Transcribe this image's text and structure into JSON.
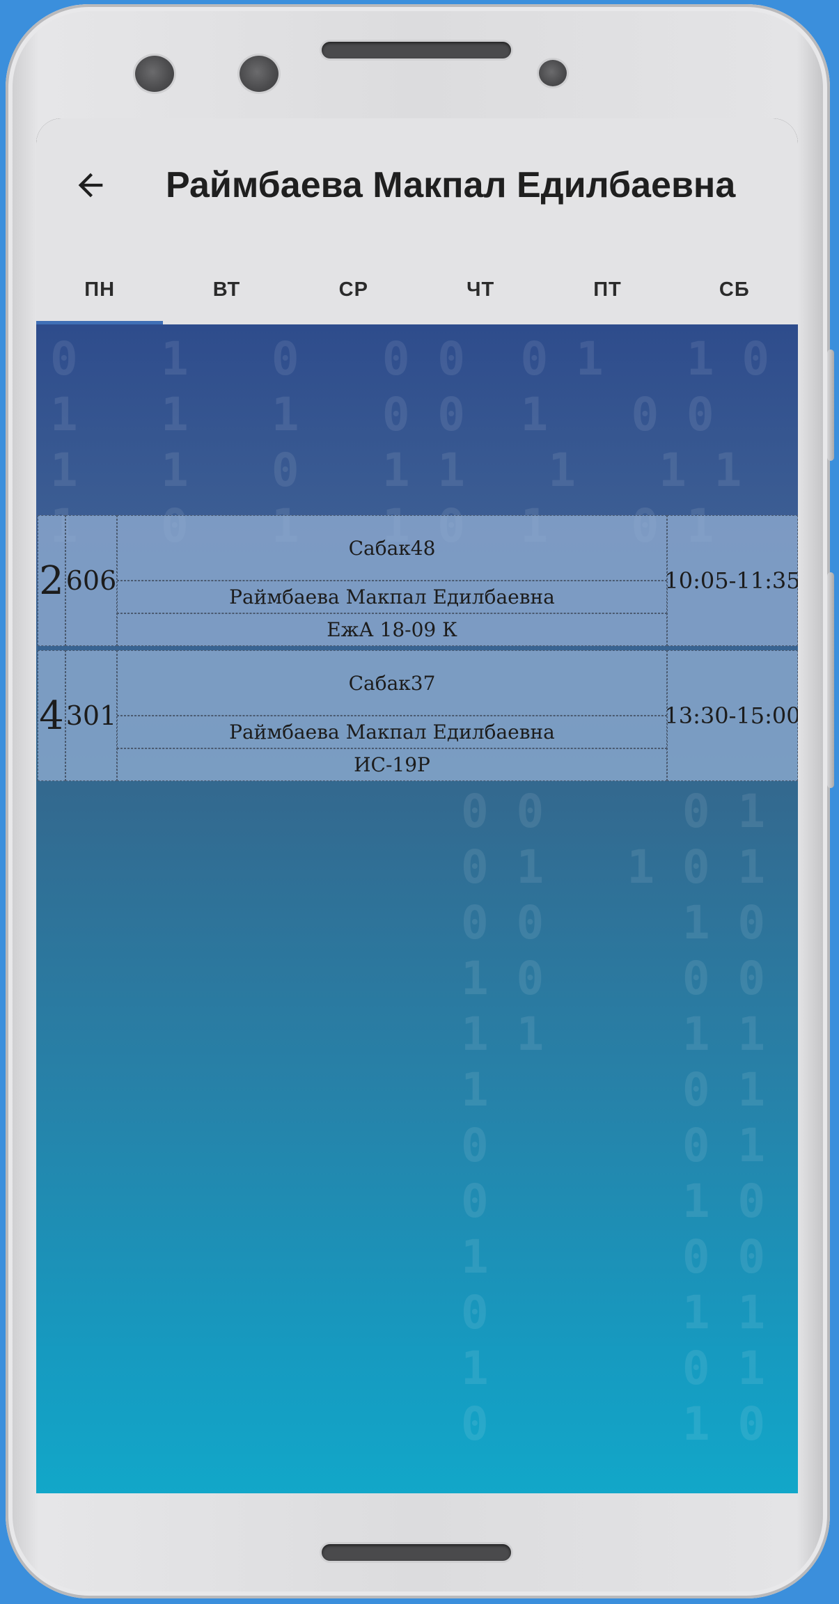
{
  "app": {
    "title": "Раймбаева Макпал Едилбаевна",
    "back_icon": "arrow-left-icon"
  },
  "tabs": [
    {
      "label": "ПН",
      "active": true
    },
    {
      "label": "ВТ",
      "active": false
    },
    {
      "label": "СР",
      "active": false
    },
    {
      "label": "ЧТ",
      "active": false
    },
    {
      "label": "ПТ",
      "active": false
    },
    {
      "label": "СБ",
      "active": false
    }
  ],
  "lessons": [
    {
      "number": "2",
      "room": "606",
      "subject": "Сабак48",
      "teacher": "Раймбаева Макпал Едилбаевна",
      "group": "ЕжА 18-09 К",
      "time": "10:05-11:35"
    },
    {
      "number": "4",
      "room": "301",
      "subject": "Сабак37",
      "teacher": "Раймбаева Макпал Едилбаевна",
      "group": "ИС-19Р",
      "time": "13:30-15:00"
    }
  ],
  "colors": {
    "accent": "#3f6fb6",
    "appbar": "#e3e3e5",
    "background_top": "#2e4c8c",
    "background_bottom": "#12a7c9"
  }
}
